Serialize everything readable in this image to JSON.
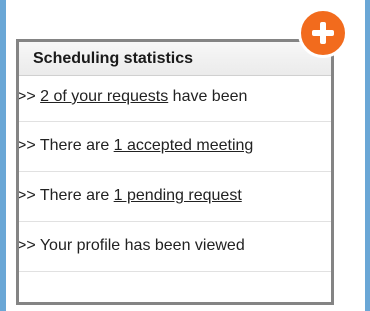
{
  "panel": {
    "title": "Scheduling statistics"
  },
  "rows": [
    {
      "prefix": ">> ",
      "link": "2 of your requests",
      "suffix": " have been"
    },
    {
      "prefix": ">> There are ",
      "link": "1 accepted meeting",
      "suffix": ""
    },
    {
      "prefix": ">> There are ",
      "link": "1 pending request",
      "suffix": ""
    },
    {
      "prefix": ">> Your profile has been viewed",
      "link": "",
      "suffix": ""
    }
  ],
  "add_button": {
    "icon": "plus-icon",
    "color": "#f26b1d"
  },
  "colors": {
    "background": "#6aa7d6",
    "panel_border": "#848484"
  }
}
